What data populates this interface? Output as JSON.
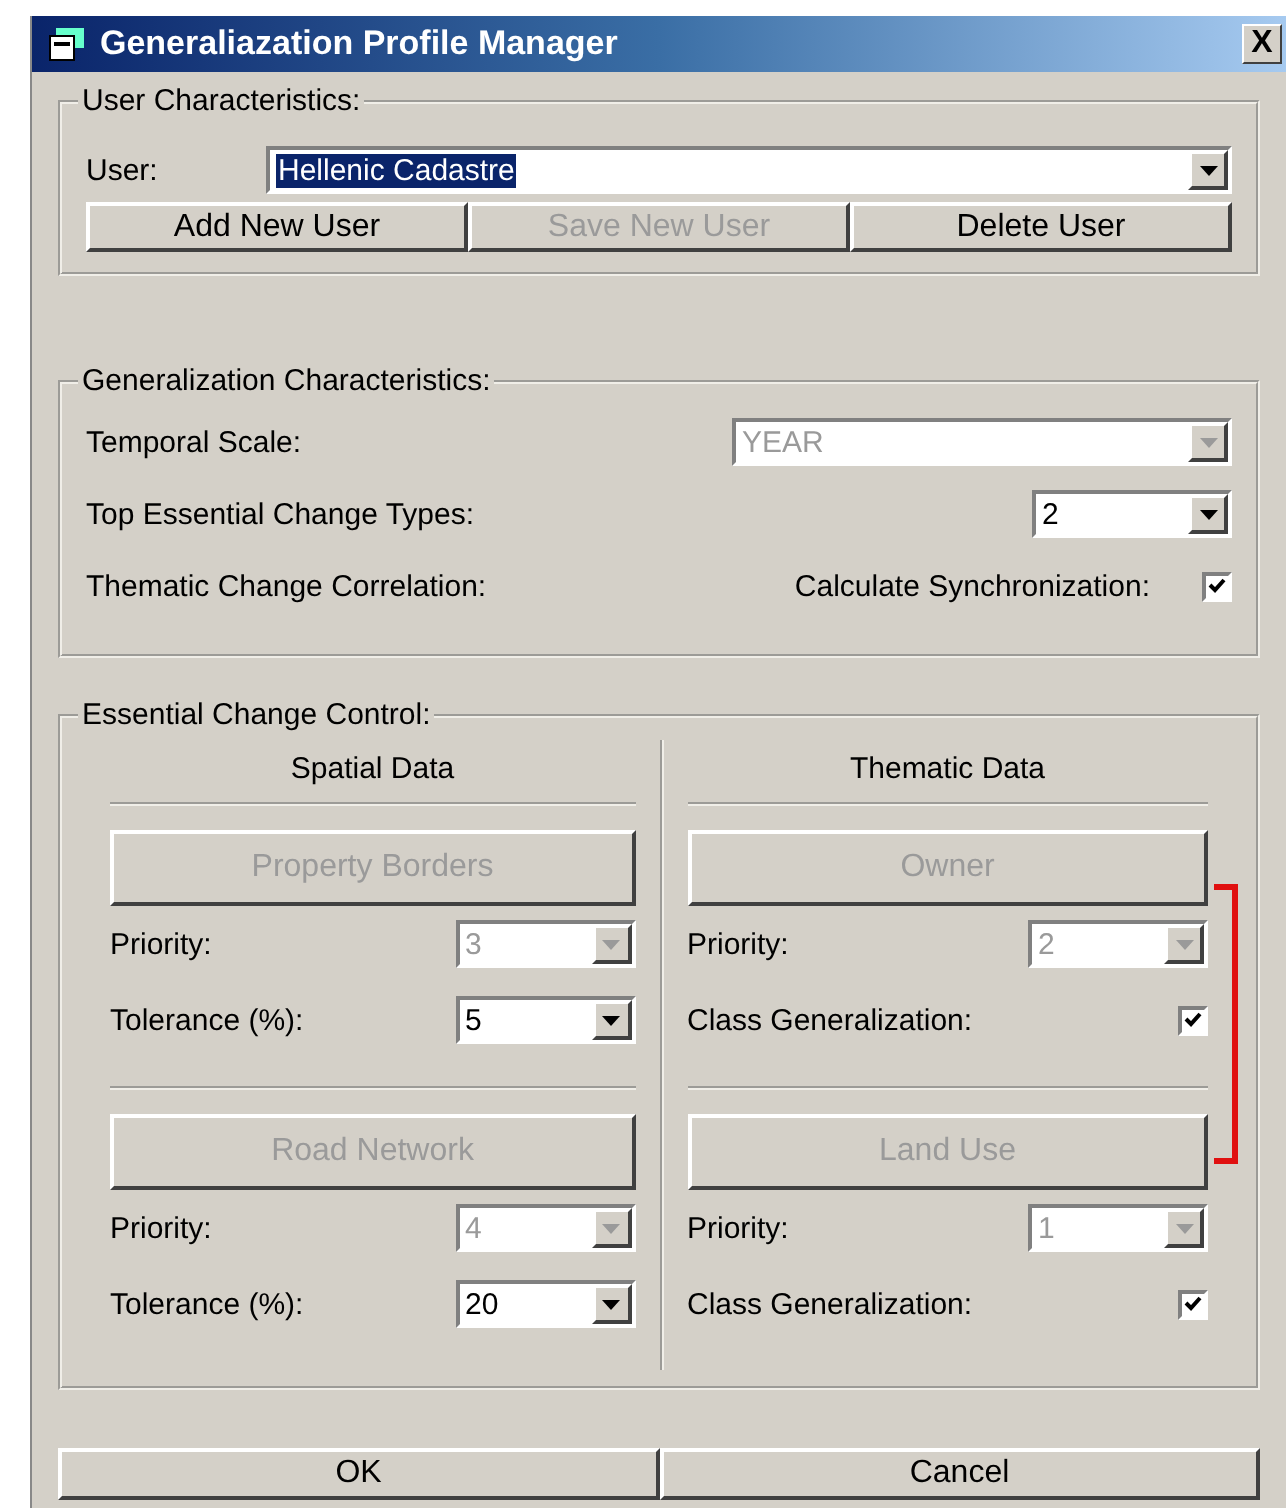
{
  "window": {
    "title": "Generaliazation Profile Manager",
    "close_button": "X"
  },
  "user_characteristics": {
    "legend": "User Characteristics:",
    "user_label": "User:",
    "user_value": "Hellenic Cadastre",
    "buttons": [
      {
        "label": "Add New User",
        "disabled": false
      },
      {
        "label": "Save New User",
        "disabled": true
      },
      {
        "label": "Delete User",
        "disabled": false
      }
    ]
  },
  "generalization_characteristics": {
    "legend": "Generalization Characteristics:",
    "rows": [
      {
        "kind": "dropdown",
        "label": "Temporal Scale:",
        "value": "YEAR",
        "disabled": true
      },
      {
        "kind": "dropdown",
        "label": "Top Essential Change Types:",
        "value": "2",
        "disabled": false
      },
      {
        "kind": "checkbox",
        "label": "Thematic Change Correlation:",
        "option": "Calculate Synchronization:",
        "checked": true
      }
    ]
  },
  "essential_change_control": {
    "legend": "Essential Change Control:",
    "linked": true,
    "columns": [
      {
        "heading": "Spatial Data",
        "sections": [
          {
            "button": "Property Borders",
            "button_disabled": true,
            "fields": [
              {
                "kind": "dropdown",
                "label": "Priority:",
                "value": "3",
                "disabled": true
              },
              {
                "kind": "dropdown",
                "label": "Tolerance (%):",
                "value": "5",
                "disabled": false
              }
            ]
          },
          {
            "button": "Road Network",
            "button_disabled": true,
            "fields": [
              {
                "kind": "dropdown",
                "label": "Priority:",
                "value": "4",
                "disabled": true
              },
              {
                "kind": "dropdown",
                "label": "Tolerance (%):",
                "value": "20",
                "disabled": false
              }
            ]
          }
        ]
      },
      {
        "heading": "Thematic Data",
        "sections": [
          {
            "button": "Owner",
            "button_disabled": true,
            "fields": [
              {
                "kind": "dropdown",
                "label": "Priority:",
                "value": "2",
                "disabled": true
              },
              {
                "kind": "checkbox",
                "label": "Class Generalization:",
                "checked": true
              }
            ]
          },
          {
            "button": "Land Use",
            "button_disabled": true,
            "fields": [
              {
                "kind": "dropdown",
                "label": "Priority:",
                "value": "1",
                "disabled": true
              },
              {
                "kind": "checkbox",
                "label": "Class Generalization:",
                "checked": true
              }
            ]
          }
        ]
      }
    ]
  },
  "buttons": [
    {
      "label": "OK"
    },
    {
      "label": "Cancel"
    }
  ]
}
